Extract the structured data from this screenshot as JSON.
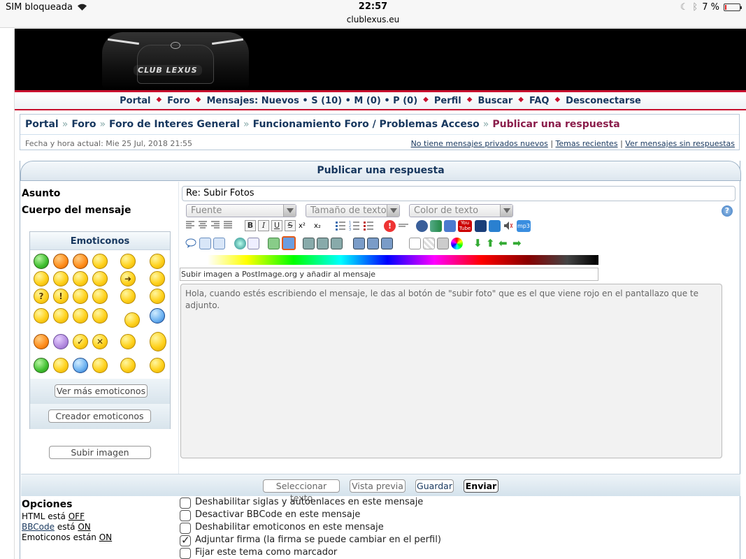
{
  "status_bar": {
    "carrier": "SIM bloqueada",
    "time": "22:57",
    "url": "clublexus.eu",
    "battery": "7 %",
    "battery_level": 0.07
  },
  "banner": {
    "logo_text": "CLUB LEXUS"
  },
  "nav": {
    "items": [
      "Portal",
      "Foro",
      "Mensajes: Nuevos • S (10) • M (0) • P (0)",
      "Perfil",
      "Buscar",
      "FAQ",
      "Desconectarse"
    ],
    "separator": "◆"
  },
  "breadcrumb": {
    "items": [
      "Portal",
      "Foro",
      "Foro de Interes General",
      "Funcionamiento Foro / Problemas Acceso"
    ],
    "current": "Publicar una respuesta",
    "sep": "»"
  },
  "info": {
    "datetime": "Fecha y hora actual: Mie 25 Jul, 2018 21:55",
    "links": [
      "No tiene mensajes privados nuevos",
      "Temas recientes",
      "Ver mensajes sin respuestas"
    ],
    "link_sep": "|"
  },
  "form": {
    "title": "Publicar una respuesta",
    "subject_label": "Asunto",
    "subject_value": "Re: Subir Fotos",
    "body_label": "Cuerpo del mensaje",
    "font_select": "Fuente",
    "size_select": "Tamaño de texto",
    "color_select": "Color de texto",
    "help": "?",
    "postimage_label": "Subir imagen a PostImage.org y añadir al mensaje",
    "message_text": "Hola, cuando estés escribiendo el mensaje, le das al botón de \"subir foto\" que es el que viene rojo en el pantallazo que te adjunto.",
    "emoticons_title": "Emoticonos",
    "more_emoticons": "Ver más emoticonos",
    "emoticon_creator": "Creador emoticonos",
    "upload_image": "Subir imagen",
    "toolbar_text": {
      "bold": "B",
      "italic": "I",
      "underline": "U",
      "strike": "S",
      "sup": "x²",
      "sub": "x₂",
      "youtube": "You Tube",
      "mp3": "mp3"
    }
  },
  "actions": {
    "select_text": "Seleccionar texto",
    "preview": "Vista previa",
    "save": "Guardar",
    "send": "Enviar"
  },
  "options": {
    "title": "Opciones",
    "html_label": "HTML está",
    "html_state": "OFF",
    "bbcode_link": "BBCode",
    "bbcode_label": "está",
    "bbcode_state": "ON",
    "emoticons_label": "Emoticonos están",
    "emoticons_state": "ON",
    "checkboxes": [
      {
        "label": "Deshabilitar siglas y autoenlaces en este mensaje",
        "checked": false
      },
      {
        "label": "Desactivar BBCode en este mensaje",
        "checked": false
      },
      {
        "label": "Deshabilitar emoticonos en este mensaje",
        "checked": false
      },
      {
        "label": "Adjuntar firma (la firma se puede cambiar en el perfil)",
        "checked": true
      },
      {
        "label": "Fijar este tema como marcador",
        "checked": false
      }
    ]
  }
}
